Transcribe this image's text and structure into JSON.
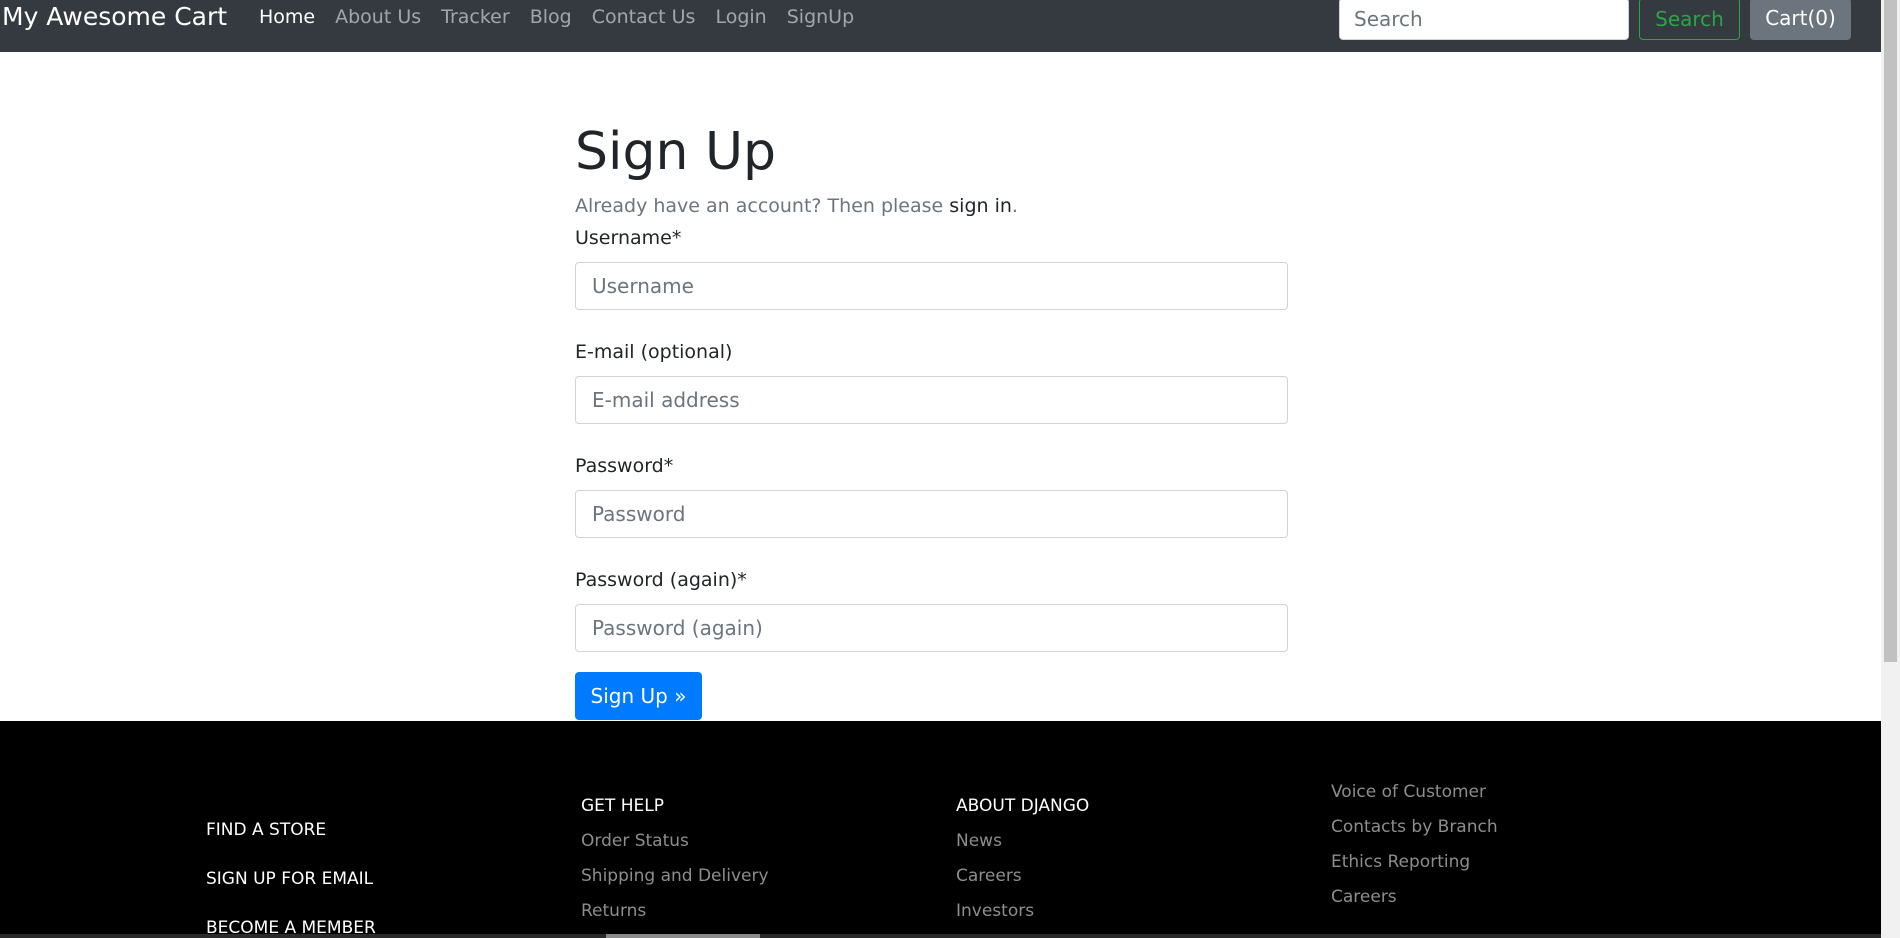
{
  "navbar": {
    "brand": "My Awesome Cart",
    "links": [
      "Home",
      "About Us",
      "Tracker",
      "Blog",
      "Contact Us",
      "Login",
      "SignUp"
    ],
    "search_placeholder": "Search",
    "search_button": "Search",
    "cart_label": "Cart(0)"
  },
  "form": {
    "title": "Sign Up",
    "subtitle_prefix": "Already have an account? Then please ",
    "subtitle_link": "sign in",
    "subtitle_suffix": ".",
    "fields": [
      {
        "label": "Username*",
        "placeholder": "Username"
      },
      {
        "label": "E-mail (optional)",
        "placeholder": "E-mail address"
      },
      {
        "label": "Password*",
        "placeholder": "Password"
      },
      {
        "label": "Password (again)*",
        "placeholder": "Password (again)"
      }
    ],
    "submit_label": "Sign Up »"
  },
  "footer": {
    "primary": [
      "FIND A STORE",
      "SIGN UP FOR EMAIL",
      "BECOME A MEMBER"
    ],
    "get_help": {
      "heading": "GET HELP",
      "links": [
        "Order Status",
        "Shipping and Delivery",
        "Returns"
      ]
    },
    "about": {
      "heading": "ABOUT DJANGO",
      "links": [
        "News",
        "Careers",
        "Investors"
      ]
    },
    "other": {
      "links": [
        "Voice of Customer",
        "Contacts by Branch",
        "Ethics Reporting",
        "Careers"
      ]
    }
  },
  "colors": {
    "navbar_bg": "#343a40",
    "primary": "#007bff",
    "success": "#28a745",
    "secondary": "#6c757d",
    "footer_bg": "#000000"
  }
}
